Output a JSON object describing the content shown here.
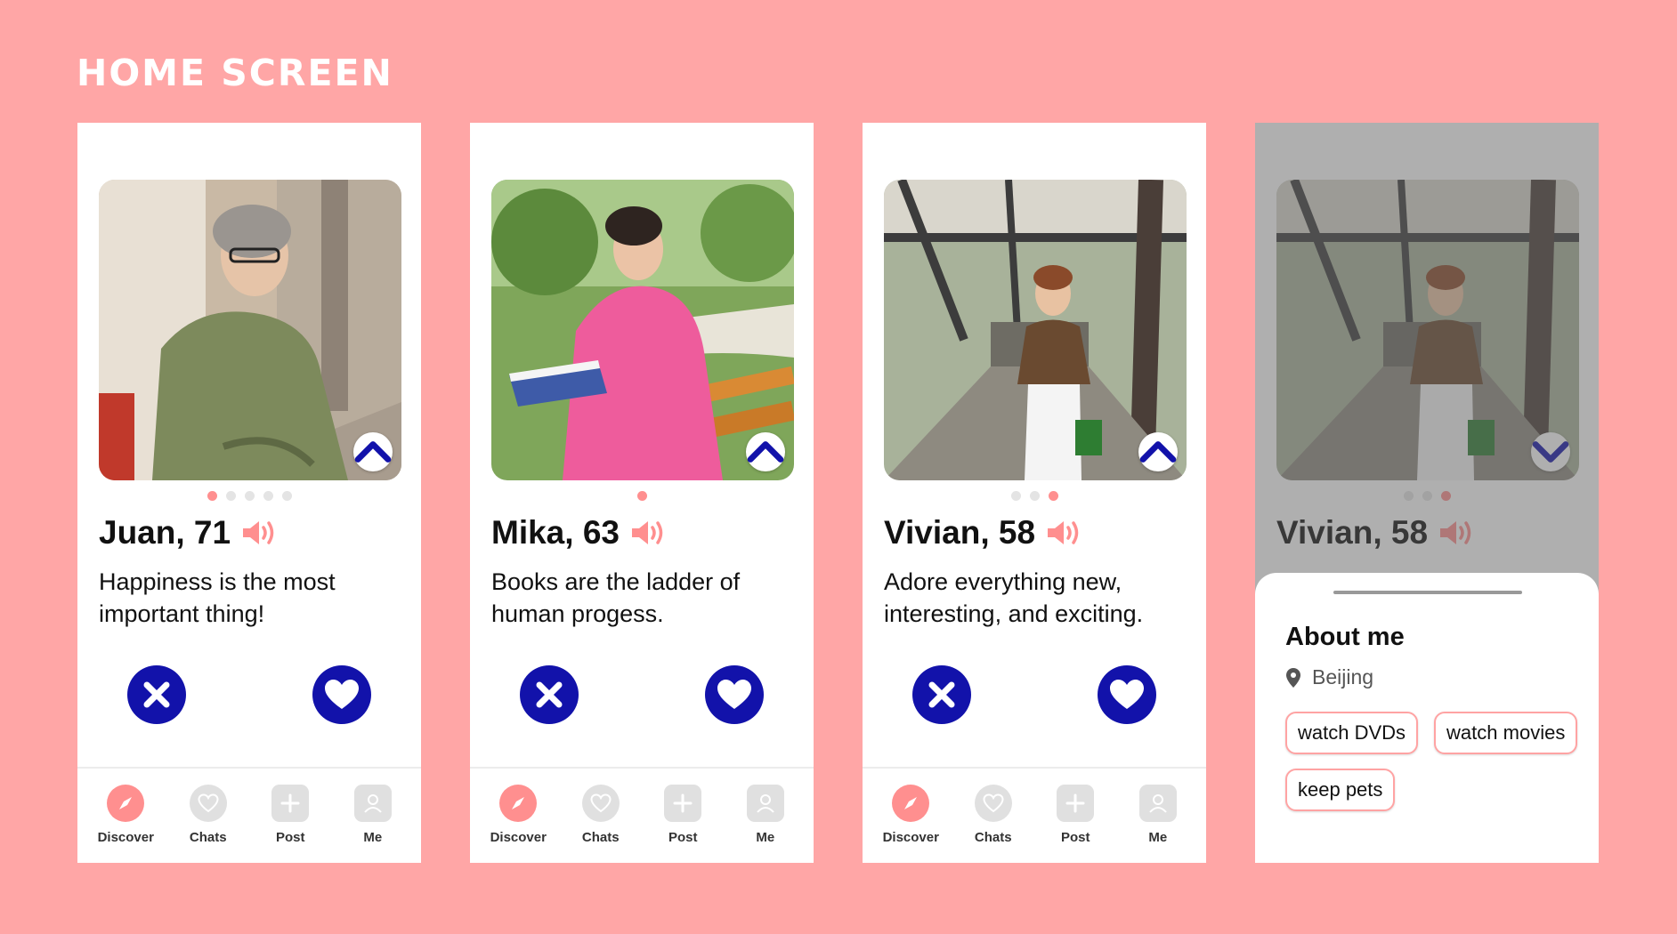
{
  "page_title": "HOME SCREEN",
  "colors": {
    "background": "#FFA6A6",
    "accent_blue": "#1212AA",
    "accent_pink": "#FF8F8F"
  },
  "tabbar": {
    "discover": "Discover",
    "chats": "Chats",
    "post": "Post",
    "me": "Me"
  },
  "profiles": [
    {
      "name": "Juan, 71",
      "bio": "Happiness is the most important thing!",
      "photo_count": 5,
      "active_photo": 1
    },
    {
      "name": "Mika, 63",
      "bio": "Books are the ladder of human progess.",
      "photo_count": 1,
      "active_photo": 1
    },
    {
      "name": "Vivian, 58",
      "bio": "Adore everything new, interesting, and exciting.",
      "photo_count": 3,
      "active_photo": 3
    },
    {
      "name": "Vivian, 58",
      "photo_count": 3,
      "active_photo": 3
    }
  ],
  "about_sheet": {
    "title": "About me",
    "location": "Beijing",
    "tags": [
      "watch DVDs",
      "watch movies",
      "keep pets"
    ]
  }
}
